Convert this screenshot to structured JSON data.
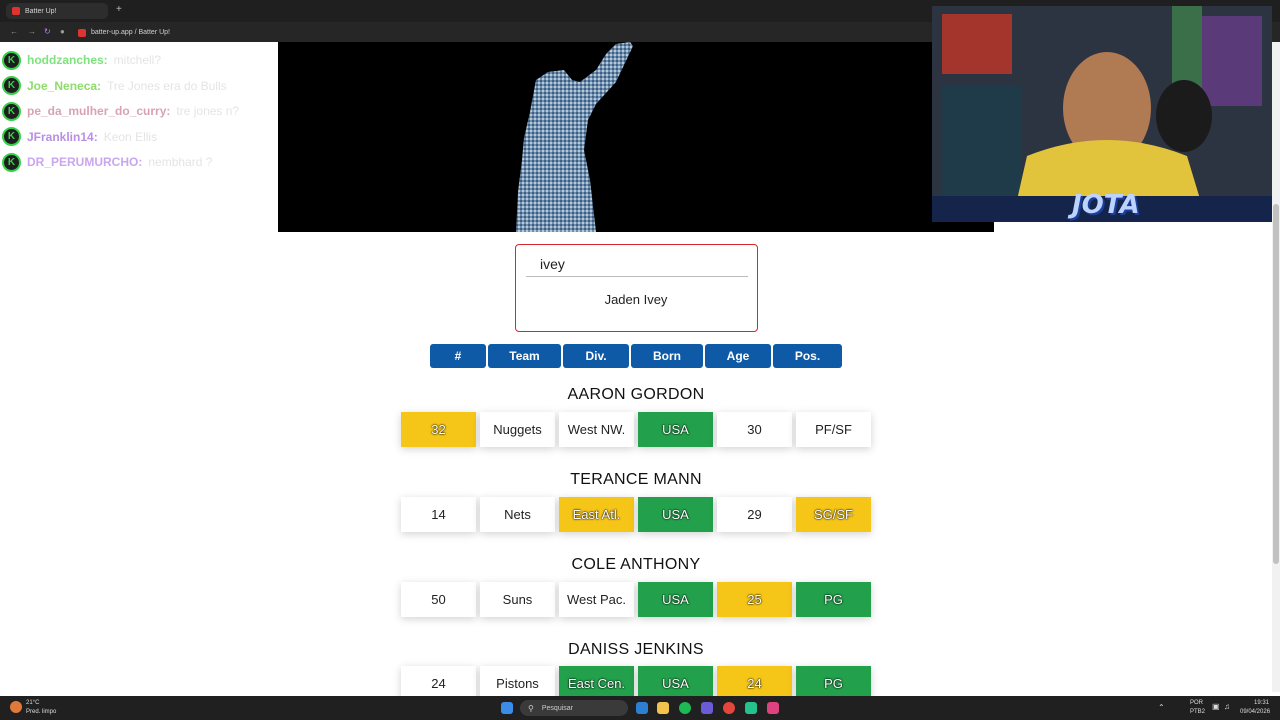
{
  "browser": {
    "tab_title": "Batter Up!",
    "new_tab": "+",
    "url": "batter-up.app / Batter Up!"
  },
  "chat": [
    {
      "user": "hoddzanches:",
      "message": "mitchell?",
      "color": "#7ee27e"
    },
    {
      "user": "Joe_Neneca:",
      "message": "Tre Jones era do Bulls",
      "color": "#8edc6a"
    },
    {
      "user": "pe_da_mulher_do_curry:",
      "message": "tre jones n?",
      "color": "#d7a3b3"
    },
    {
      "user": "JFranklin14:",
      "message": "Keon Ellis",
      "color": "#b98fe6"
    },
    {
      "user": "DR_PERUMURCHO:",
      "message": "nembhard ?",
      "color": "#c9a6ef"
    }
  ],
  "stream": {
    "logo": "JOTA"
  },
  "game": {
    "search_value": "ivey",
    "suggestion": "Jaden Ivey",
    "headers": [
      "#",
      "Team",
      "Div.",
      "Born",
      "Age",
      "Pos."
    ],
    "players": [
      {
        "name": "AARON GORDON",
        "cells": [
          {
            "text": "32",
            "status": "yellow"
          },
          {
            "text": "Nuggets",
            "status": "none"
          },
          {
            "text": "West NW.",
            "status": "none"
          },
          {
            "text": "USA",
            "status": "green"
          },
          {
            "text": "30",
            "status": "none"
          },
          {
            "text": "PF/SF",
            "status": "none"
          }
        ]
      },
      {
        "name": "TERANCE MANN",
        "cells": [
          {
            "text": "14",
            "status": "none"
          },
          {
            "text": "Nets",
            "status": "none"
          },
          {
            "text": "East Atl.",
            "status": "yellow"
          },
          {
            "text": "USA",
            "status": "green"
          },
          {
            "text": "29",
            "status": "none"
          },
          {
            "text": "SG/SF",
            "status": "yellow"
          }
        ]
      },
      {
        "name": "COLE ANTHONY",
        "cells": [
          {
            "text": "50",
            "status": "none"
          },
          {
            "text": "Suns",
            "status": "none"
          },
          {
            "text": "West Pac.",
            "status": "none"
          },
          {
            "text": "USA",
            "status": "green"
          },
          {
            "text": "25",
            "status": "yellow"
          },
          {
            "text": "PG",
            "status": "green"
          }
        ]
      },
      {
        "name": "DANISS JENKINS",
        "cells": [
          {
            "text": "24",
            "status": "none"
          },
          {
            "text": "Pistons",
            "status": "none"
          },
          {
            "text": "East Cen.",
            "status": "green"
          },
          {
            "text": "USA",
            "status": "green"
          },
          {
            "text": "24",
            "status": "yellow"
          },
          {
            "text": "PG",
            "status": "green"
          }
        ]
      }
    ]
  },
  "taskbar": {
    "weather_temp": "21°C",
    "weather_desc": "Pred. limpo",
    "search_placeholder": "Pesquisar",
    "lang": "POR",
    "layout": "PTB2",
    "time": "19:31",
    "date": "09/04/2026"
  }
}
